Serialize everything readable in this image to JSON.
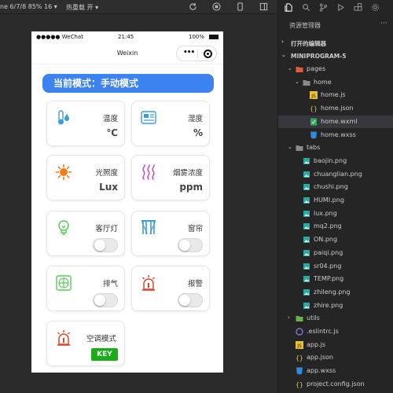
{
  "toolbar": {
    "device_label": "ne 6/7/8 85% 16 ▾",
    "hot_reload_label": "热重载 开 ▾"
  },
  "phone": {
    "carrier": "●●●●● WeChat",
    "time": "21:45",
    "battery": "100%",
    "battery_level": 1.0,
    "nav_title": "Weixin",
    "capsule_dots": "•••"
  },
  "mode_banner": "当前模式：手动模式",
  "cards": {
    "temperature": {
      "label": "温度",
      "value": "℃"
    },
    "humidity": {
      "label": "湿度",
      "value": "%"
    },
    "light": {
      "label": "光照度",
      "value": "Lux"
    },
    "smoke": {
      "label": "烟雾浓度",
      "value": "ppm"
    },
    "living_light": {
      "label": "客厅灯",
      "switch_on": false
    },
    "curtain": {
      "label": "窗帘",
      "switch_on": false
    },
    "exhaust": {
      "label": "排气",
      "switch_on": false
    },
    "alarm": {
      "label": "报警",
      "switch_on": false
    },
    "ac_mode": {
      "label": "空调模式",
      "button": "KEY"
    }
  },
  "explorer": {
    "header": "资源管理器",
    "more": "···",
    "open_editors": "打开的编辑器",
    "project": "MINIPROGRAM-5",
    "tree": [
      {
        "name": "pages",
        "type": "folder",
        "expanded": true
      },
      {
        "name": "home",
        "type": "folder",
        "expanded": true
      },
      {
        "name": "home.js",
        "type": "js"
      },
      {
        "name": "home.json",
        "type": "json"
      },
      {
        "name": "home.wxml",
        "type": "wxml",
        "selected": true
      },
      {
        "name": "home.wxss",
        "type": "wxss"
      },
      {
        "name": "tabs",
        "type": "folder",
        "expanded": true
      },
      {
        "name": "baojin.png",
        "type": "png"
      },
      {
        "name": "chuanglian.png",
        "type": "png"
      },
      {
        "name": "chushi.png",
        "type": "png"
      },
      {
        "name": "HUMI.png",
        "type": "png"
      },
      {
        "name": "lux.png",
        "type": "png"
      },
      {
        "name": "mq2.png",
        "type": "png"
      },
      {
        "name": "ON.png",
        "type": "png"
      },
      {
        "name": "paiqi.png",
        "type": "png"
      },
      {
        "name": "sr04.png",
        "type": "png"
      },
      {
        "name": "TEMP.png",
        "type": "png"
      },
      {
        "name": "zhileng.png",
        "type": "png"
      },
      {
        "name": "zhire.png",
        "type": "png"
      },
      {
        "name": "utils",
        "type": "folder",
        "expanded": false
      },
      {
        "name": ".eslintrc.js",
        "type": "eslint"
      },
      {
        "name": "app.js",
        "type": "js"
      },
      {
        "name": "app.json",
        "type": "json"
      },
      {
        "name": "app.wxss",
        "type": "wxss"
      },
      {
        "name": "project.config.json",
        "type": "json"
      }
    ]
  },
  "colors": {
    "accent_blue": "#3c82f0",
    "key_green": "#1aad19",
    "selected_row": "#37373d"
  }
}
